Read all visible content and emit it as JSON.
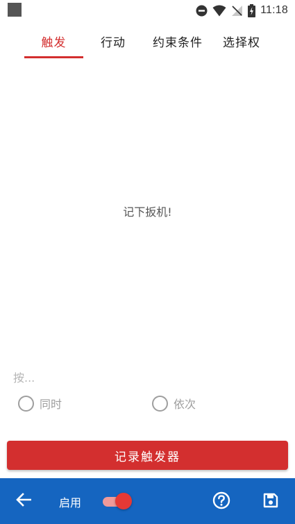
{
  "status_bar": {
    "time": "11:18",
    "icons": [
      "app-square-icon",
      "do-not-disturb-icon",
      "wifi-icon",
      "no-sim-icon",
      "battery-charging-icon"
    ]
  },
  "tabs": [
    {
      "label": "触发",
      "active": true
    },
    {
      "label": "行动",
      "active": false
    },
    {
      "label": "约束条件",
      "active": false
    },
    {
      "label": "选择权",
      "active": false
    }
  ],
  "main": {
    "empty_message": "记下扳机!",
    "press_hint": "按...",
    "radio_options": [
      {
        "label": "同时",
        "selected": false
      },
      {
        "label": "依次",
        "selected": false
      }
    ],
    "record_button": "记录触发器"
  },
  "bottom_bar": {
    "back_icon": "arrow-left-icon",
    "enable_label": "启用",
    "enabled": true,
    "help_icon": "help-circle-icon",
    "save_icon": "floppy-disk-icon"
  },
  "colors": {
    "accent": "#d32f2f",
    "bottom_bar": "#1565c0",
    "toggle_track": "#ef9a9a",
    "toggle_thumb": "#e53935"
  }
}
